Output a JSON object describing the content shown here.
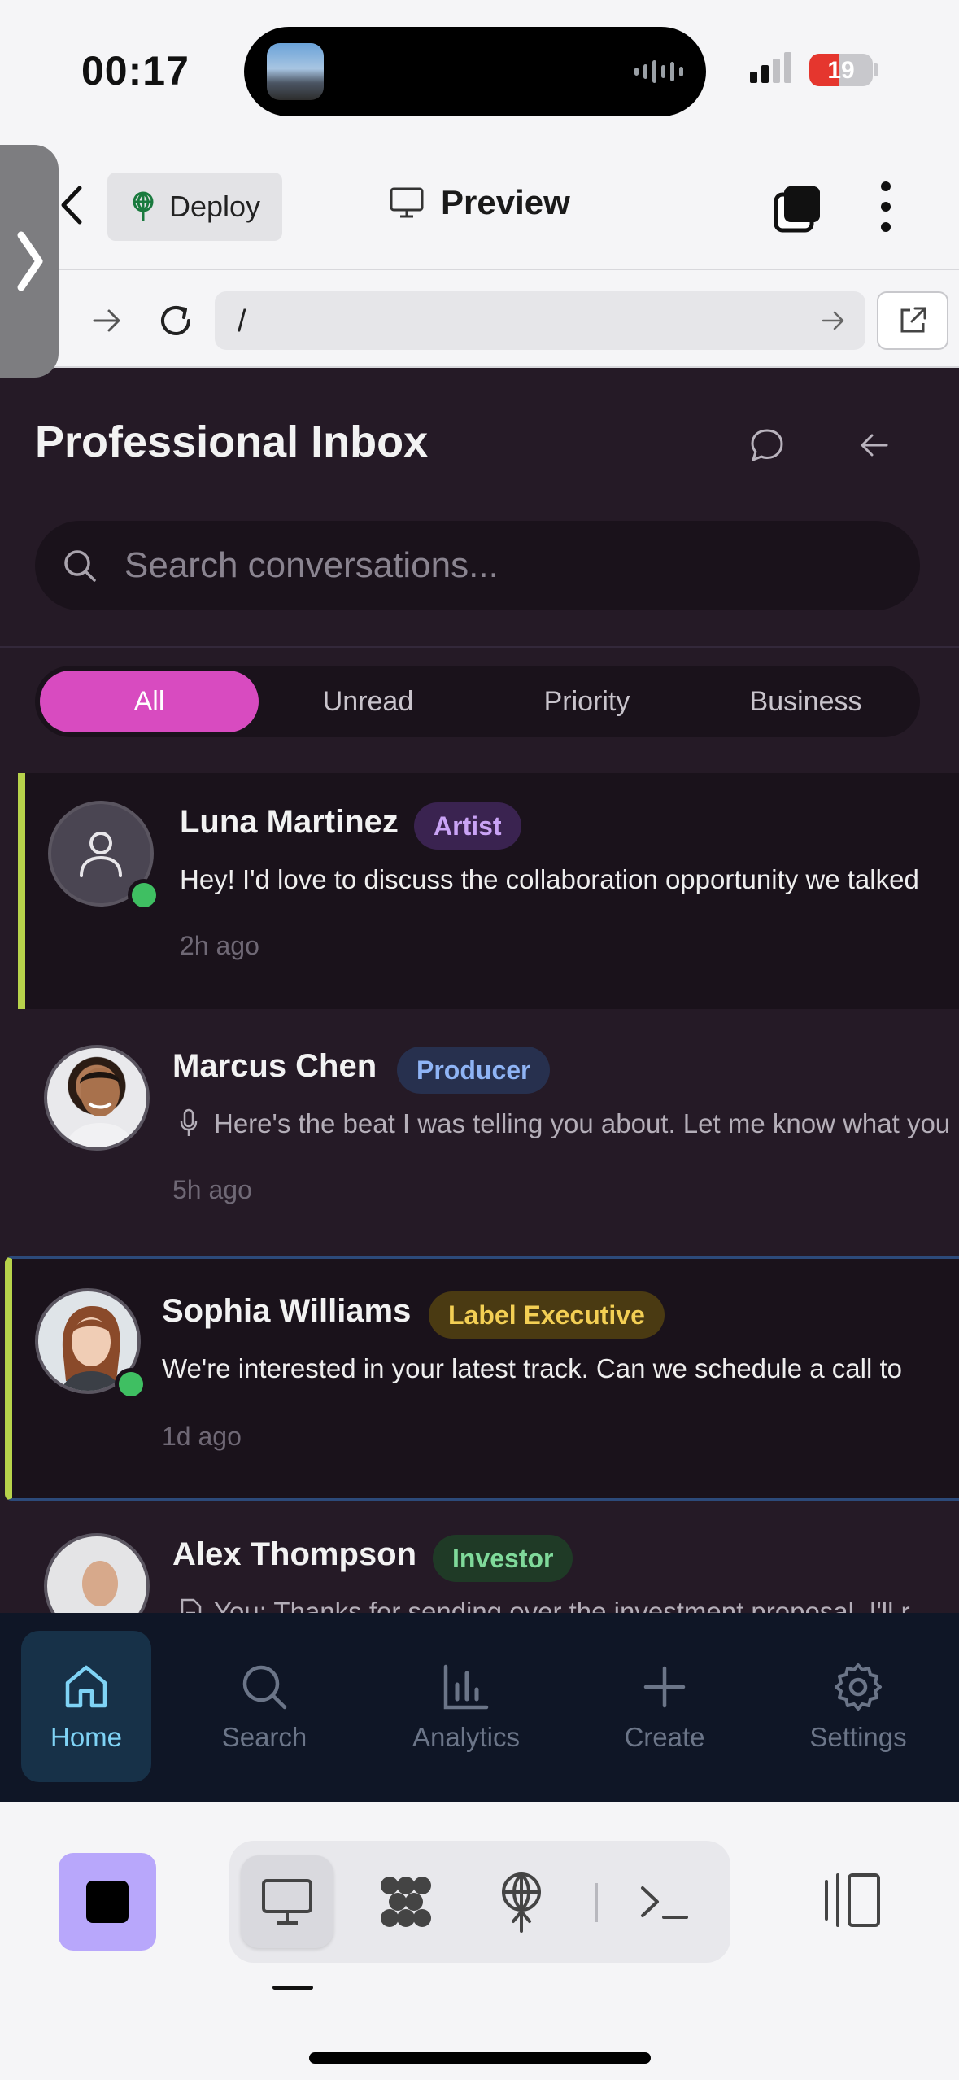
{
  "status_bar": {
    "time": "00:17",
    "battery": "19"
  },
  "toolbar": {
    "deploy_label": "Deploy",
    "preview_label": "Preview"
  },
  "url_bar": {
    "path": "/"
  },
  "app": {
    "title": "Professional Inbox",
    "search_placeholder": "Search conversations...",
    "filters": [
      "All",
      "Unread",
      "Priority",
      "Business"
    ],
    "active_filter": "All",
    "conversations": [
      {
        "name": "Luna Martinez",
        "role": "Artist",
        "preview": "Hey! I'd love to discuss the collaboration opportunity we talked",
        "time": "2h ago",
        "online": true,
        "unread": true
      },
      {
        "name": "Marcus Chen",
        "role": "Producer",
        "preview": "Here's the beat I was telling you about. Let me know what you",
        "time": "5h ago",
        "online": false,
        "voice": true
      },
      {
        "name": "Sophia Williams",
        "role": "Label Executive",
        "preview": "We're interested in your latest track. Can we schedule a call to",
        "time": "1d ago",
        "online": true,
        "unread": true
      },
      {
        "name": "Alex Thompson",
        "role": "Investor",
        "preview": "You: Thanks for sending over the investment proposal. I'll r",
        "time": "",
        "online": false
      }
    ],
    "badge_colors": {
      "Artist": {
        "bg": "#3a2350",
        "fg": "#c9a3f5"
      },
      "Producer": {
        "bg": "#27304e",
        "fg": "#8fb4f5"
      },
      "Label Executive": {
        "bg": "#4a3a12",
        "fg": "#f3cf54"
      },
      "Investor": {
        "bg": "#1f3a26",
        "fg": "#7fd99a"
      }
    }
  },
  "bottom_nav": [
    {
      "label": "Home",
      "icon": "home-icon",
      "active": true
    },
    {
      "label": "Search",
      "icon": "search-icon",
      "active": false
    },
    {
      "label": "Analytics",
      "icon": "analytics-icon",
      "active": false
    },
    {
      "label": "Create",
      "icon": "plus-icon",
      "active": false
    },
    {
      "label": "Settings",
      "icon": "gear-icon",
      "active": false
    }
  ],
  "colors": {
    "accent": "#d84bc0",
    "app_bg": "#251a26",
    "nav_bg": "#0f1626",
    "nav_active": "#7fd3f5",
    "online": "#3fbf62"
  }
}
